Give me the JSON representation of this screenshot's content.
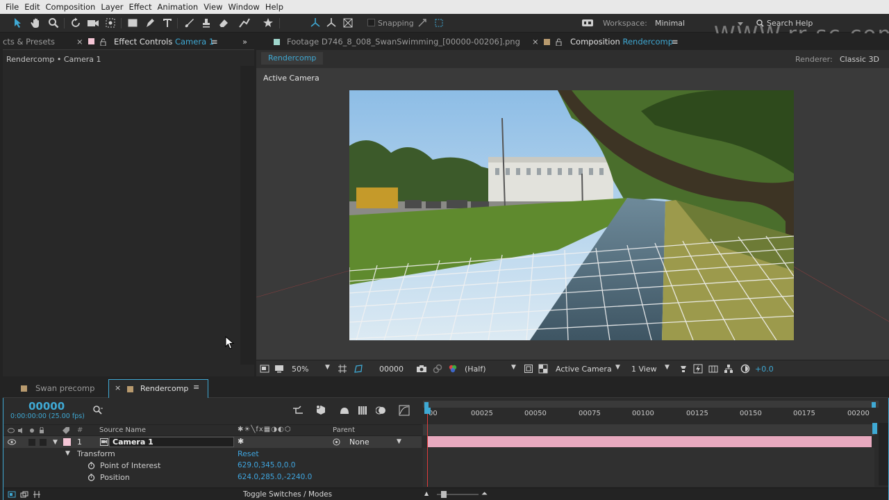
{
  "menu": [
    "File",
    "Edit",
    "Composition",
    "Layer",
    "Effect",
    "Animation",
    "View",
    "Window",
    "Help"
  ],
  "toolbar": {
    "snapping_label": "Snapping",
    "workspace_label": "Workspace:",
    "workspace_value": "Minimal",
    "search_help": "Search Help",
    "watermark": "WWW.rr-sc.com"
  },
  "left_panel": {
    "tab_effects_presets": "cts & Presets",
    "tab_effect_controls": "Effect Controls",
    "tab_effect_controls_target": "Camera 1",
    "breadcrumb": "Rendercomp • Camera 1"
  },
  "comp_panel": {
    "tab_footage": "Footage D746_8_008_SwanSwimming_[00000-00206].png",
    "tab_comp_prefix": "Composition",
    "tab_comp_name": "Rendercomp",
    "sub_tab": "Rendercomp",
    "renderer_label": "Renderer:",
    "renderer_value": "Classic 3D",
    "view_label": "Active Camera"
  },
  "viewer_footer": {
    "zoom": "50%",
    "timecode": "00000",
    "resolution": "(Half)",
    "camera_view": "Active Camera",
    "views": "1 View",
    "exposure": "+0.0"
  },
  "timeline": {
    "tabs": [
      {
        "label": "Swan precomp",
        "color": "#b89a6e"
      },
      {
        "label": "Rendercomp",
        "color": "#b89a6e"
      }
    ],
    "current_time": "00000",
    "time_detail": "0:00:00:00 (25.00 fps)",
    "col_source_name": "Source Name",
    "col_parent": "Parent",
    "col_hash": "#",
    "layer": {
      "index": "1",
      "name": "Camera 1",
      "parent": "None",
      "color": "#f5c6d6"
    },
    "transform_label": "Transform",
    "reset_label": "Reset",
    "properties": [
      {
        "name": "Point of Interest",
        "value": "629.0,345.0,0.0"
      },
      {
        "name": "Position",
        "value": "624.0,285.0,-2240.0"
      }
    ],
    "toggle_label": "Toggle Switches / Modes",
    "ruler": [
      "00",
      "00025",
      "00050",
      "00075",
      "00100",
      "00125",
      "00150",
      "00175",
      "00200"
    ]
  },
  "colors": {
    "accent": "#3fa9d4",
    "label_pink": "#f5c6d6",
    "layer_bar": "#e8a9bf"
  }
}
